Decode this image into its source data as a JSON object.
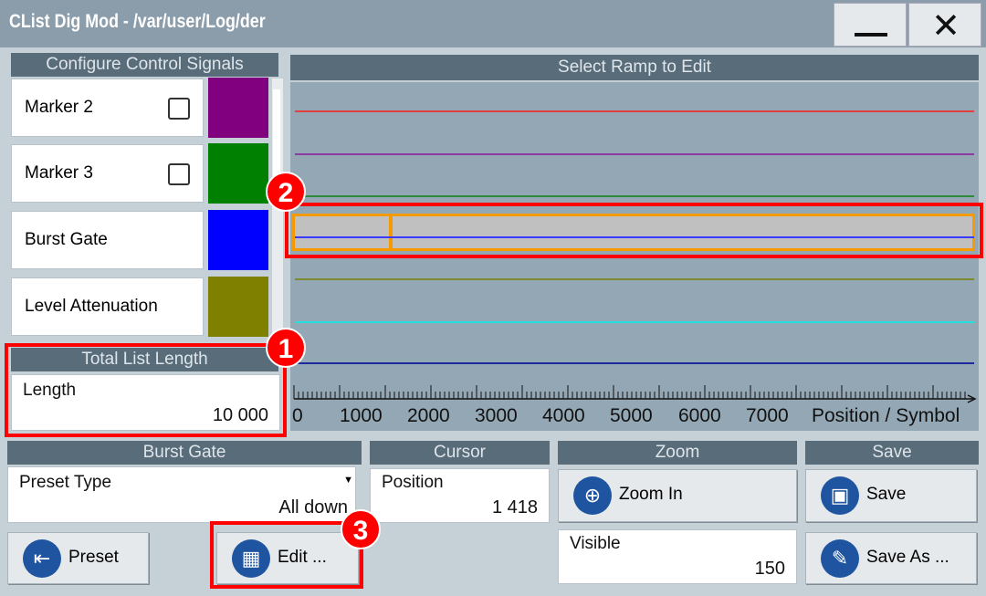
{
  "window": {
    "title": "CList Dig Mod - /var/user/Log/der",
    "minimize": "minimize-icon",
    "close": "close-icon"
  },
  "signals": {
    "header": "Configure Control Signals",
    "items": [
      {
        "label": "Marker 2",
        "checked": false,
        "color": "#800080"
      },
      {
        "label": "Marker 3",
        "checked": false,
        "color": "#008000"
      },
      {
        "label": "Burst Gate",
        "color": "#0000ff"
      },
      {
        "label": "Level Attenuation",
        "color": "#808000"
      }
    ]
  },
  "total": {
    "header": "Total List Length",
    "label": "Length",
    "value": "10 000"
  },
  "ramp": {
    "header": "Select Ramp to Edit",
    "traces": [
      "#e04040",
      "#8a3aa0",
      "#2d8a3a",
      "#3b3bff",
      "#7f8a30",
      "#20e0e0",
      "#1a2a9a"
    ],
    "selected_index": 3,
    "axis": {
      "ticks": [
        "0",
        "1000",
        "2000",
        "3000",
        "4000",
        "5000",
        "6000",
        "7000"
      ],
      "label": "Position / Symbol"
    }
  },
  "burst": {
    "header": "Burst Gate",
    "preset_label": "Preset Type",
    "preset_value": "All down",
    "preset_button": "Preset",
    "edit_button": "Edit ..."
  },
  "cursor": {
    "header": "Cursor",
    "label": "Position",
    "value": "1 418"
  },
  "zoom": {
    "header": "Zoom",
    "zoom_in": "Zoom In",
    "visible_label": "Visible",
    "visible_value": "150"
  },
  "save": {
    "header": "Save",
    "save": "Save",
    "save_as": "Save As ..."
  },
  "callouts": [
    "1",
    "2",
    "3"
  ]
}
